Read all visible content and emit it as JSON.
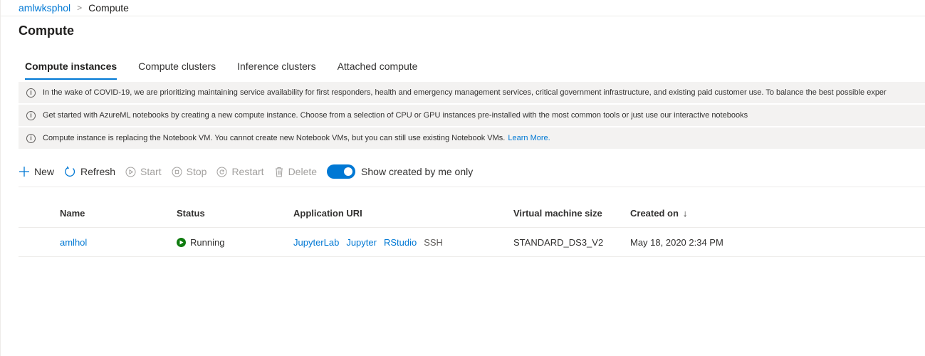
{
  "breadcrumb": {
    "workspace": "amlwksphol",
    "separator": ">",
    "current": "Compute"
  },
  "page_title": "Compute",
  "tabs": [
    {
      "label": "Compute instances",
      "active": true
    },
    {
      "label": "Compute clusters",
      "active": false
    },
    {
      "label": "Inference clusters",
      "active": false
    },
    {
      "label": "Attached compute",
      "active": false
    }
  ],
  "notices": [
    {
      "icon": "info-icon",
      "text": "In the wake of COVID-19, we are prioritizing maintaining service availability for first responders, health and emergency management services, critical government infrastructure, and existing paid customer use. To balance the best possible exper"
    },
    {
      "icon": "info-icon",
      "text": "Get started with AzureML notebooks by creating a new compute instance. Choose from a selection of CPU or GPU instances pre-installed with the most common tools or just use our interactive notebooks"
    },
    {
      "icon": "info-icon",
      "text": "Compute instance is replacing the Notebook VM. You cannot create new Notebook VMs, but you can still use existing Notebook VMs.",
      "link": "Learn More."
    }
  ],
  "toolbar": {
    "new": "New",
    "refresh": "Refresh",
    "start": "Start",
    "stop": "Stop",
    "restart": "Restart",
    "delete": "Delete",
    "toggle_label": "Show created by me only",
    "toggle_on": true
  },
  "grid": {
    "columns": [
      "Name",
      "Status",
      "Application URI",
      "Virtual machine size",
      "Created on"
    ],
    "sort_indicator": "↓",
    "rows": [
      {
        "name": "amlhol",
        "status": "Running",
        "uris": [
          "JupyterLab",
          "Jupyter",
          "RStudio"
        ],
        "ssh": "SSH",
        "vm_size": "STANDARD_DS3_V2",
        "created_on": "May 18, 2020 2:34 PM"
      }
    ]
  },
  "colors": {
    "accent": "#0078d4",
    "running": "#107c10",
    "notice_bg": "#f3f2f1"
  }
}
